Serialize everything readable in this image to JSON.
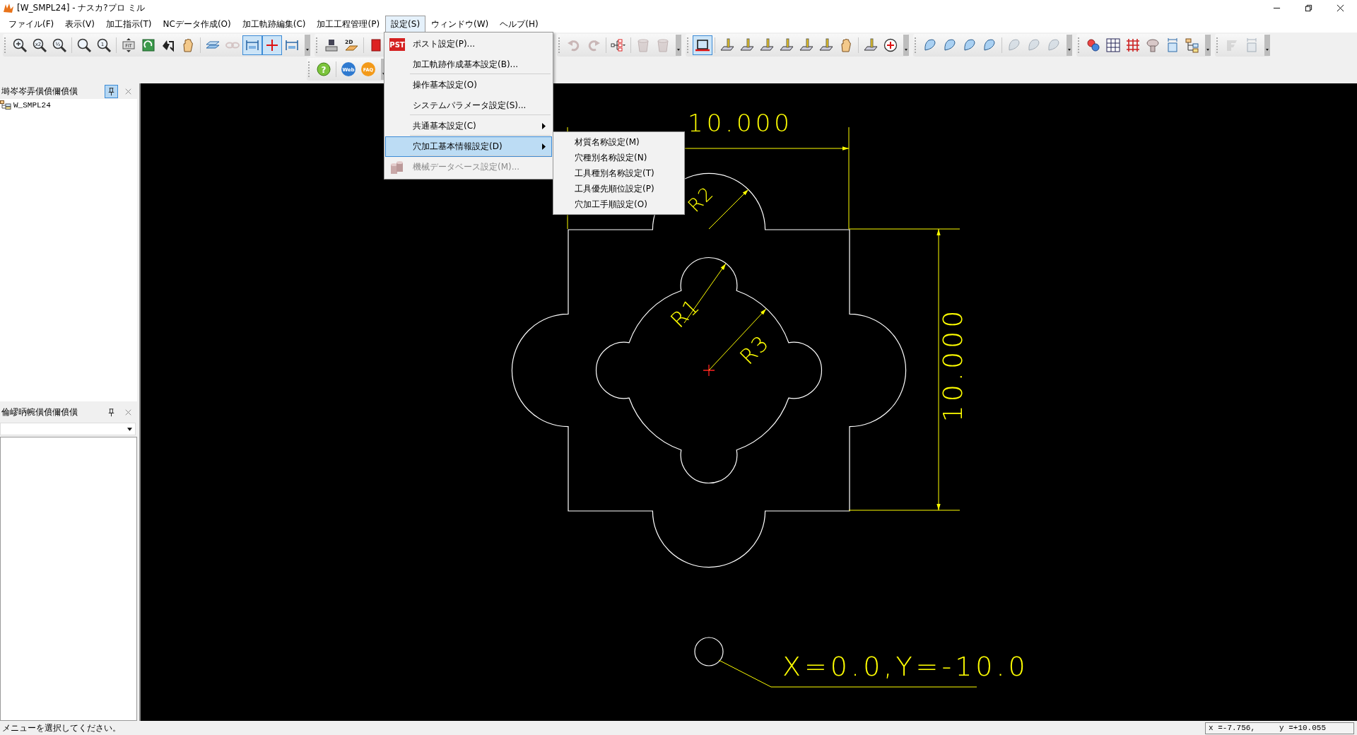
{
  "window": {
    "title": "[W_SMPL24] - ナスカ?プロ ミル"
  },
  "menu_bar": [
    {
      "label": "ファイル(F)",
      "selected": false
    },
    {
      "label": "表示(V)",
      "selected": false
    },
    {
      "label": "加工指示(T)",
      "selected": false
    },
    {
      "label": "NCデータ作成(O)",
      "selected": false
    },
    {
      "label": "加工軌跡編集(C)",
      "selected": false
    },
    {
      "label": "加工工程管理(P)",
      "selected": false
    },
    {
      "label": "設定(S)",
      "selected": true
    },
    {
      "label": "ウィンドウ(W)",
      "selected": false
    },
    {
      "label": "ヘルプ(H)",
      "selected": false
    }
  ],
  "toolbar": {
    "main": [
      [
        [
          {
            "selected": false,
            "disabled": false
          },
          {
            "selected": false,
            "disabled": false,
            "badge": "x2"
          },
          {
            "selected": false,
            "disabled": false,
            "badge": "½"
          }
        ],
        [
          {
            "selected": false,
            "disabled": false
          },
          {
            "selected": false,
            "disabled": false,
            "badge": "1"
          }
        ],
        [
          {
            "selected": false,
            "disabled": false,
            "badge": "FIT"
          },
          {
            "selected": false,
            "disabled": false
          },
          {
            "selected": false,
            "disabled": false
          },
          {
            "selected": false,
            "disabled": false
          }
        ],
        [
          {
            "selected": false,
            "disabled": false
          },
          {
            "selected": false,
            "disabled": true
          },
          {
            "selected": true,
            "disabled": false
          },
          {
            "selected": true,
            "disabled": false
          },
          {
            "selected": false,
            "disabled": false
          }
        ]
      ],
      [
        [
          {
            "selected": false,
            "disabled": false
          },
          {
            "selected": false,
            "disabled": false,
            "badge": "2D"
          }
        ],
        [
          {
            "selected": false,
            "disabled": false
          }
        ]
      ],
      [
        [
          {
            "selected": false,
            "disabled": true
          },
          {
            "selected": false,
            "disabled": true
          }
        ],
        [
          {
            "selected": false,
            "disabled": false
          }
        ],
        [
          {
            "selected": false,
            "disabled": true
          },
          {
            "selected": false,
            "disabled": true
          }
        ]
      ],
      [
        [
          {
            "selected": true,
            "disabled": false
          }
        ],
        [
          {
            "selected": false,
            "disabled": false
          },
          {
            "selected": false,
            "disabled": false
          },
          {
            "selected": false,
            "disabled": false
          },
          {
            "selected": false,
            "disabled": false
          },
          {
            "selected": false,
            "disabled": false
          },
          {
            "selected": false,
            "disabled": false
          },
          {
            "selected": false,
            "disabled": false
          }
        ],
        [
          {
            "selected": false,
            "disabled": false
          },
          {
            "selected": false,
            "disabled": false
          }
        ]
      ],
      [
        [
          {
            "selected": false,
            "disabled": false
          },
          {
            "selected": false,
            "disabled": false
          },
          {
            "selected": false,
            "disabled": false
          },
          {
            "selected": false,
            "disabled": false
          }
        ],
        [
          {
            "selected": false,
            "disabled": true
          },
          {
            "selected": false,
            "disabled": true
          },
          {
            "selected": false,
            "disabled": true
          }
        ]
      ],
      [
        [
          {
            "selected": false,
            "disabled": false
          },
          {
            "selected": false,
            "disabled": false
          },
          {
            "selected": false,
            "disabled": false
          },
          {
            "selected": false,
            "disabled": false
          },
          {
            "selected": false,
            "disabled": false
          },
          {
            "selected": false,
            "disabled": false
          }
        ]
      ],
      [
        [
          {
            "selected": false,
            "disabled": true
          },
          {
            "selected": false,
            "disabled": true
          }
        ]
      ]
    ],
    "secondary": [
      [
        [
          {
            "selected": false,
            "disabled": false,
            "badge": "?"
          }
        ],
        [
          {
            "selected": false,
            "disabled": false,
            "badge": "Web"
          },
          {
            "selected": false,
            "disabled": false,
            "badge": "FAQ"
          }
        ]
      ]
    ]
  },
  "settings_menu": {
    "items": [
      {
        "label": "ポスト設定(P)...",
        "badge": "PST",
        "disabled": false,
        "selected": false,
        "submenu": false,
        "separator_after": false
      },
      {
        "label": "加工軌跡作成基本設定(B)...",
        "disabled": false,
        "selected": false,
        "submenu": false,
        "separator_after": true
      },
      {
        "label": "操作基本設定(O)",
        "disabled": false,
        "selected": false,
        "submenu": false,
        "separator_after": false
      },
      {
        "label": "システムパラメータ設定(S)...",
        "disabled": false,
        "selected": false,
        "submenu": false,
        "separator_after": true
      },
      {
        "label": "共通基本設定(C)",
        "disabled": false,
        "selected": false,
        "submenu": true,
        "separator_after": true
      },
      {
        "label": "穴加工基本情報設定(D)",
        "disabled": false,
        "selected": true,
        "submenu": true,
        "separator_after": true
      },
      {
        "label": "機械データベース設定(M)...",
        "disabled": true,
        "selected": false,
        "submenu": false,
        "separator_after": false
      }
    ],
    "submenu": [
      {
        "label": "材質名称設定(M)"
      },
      {
        "label": "穴種別名称設定(N)"
      },
      {
        "label": "工具種別名称設定(T)"
      },
      {
        "label": "工具優先順位設定(P)"
      },
      {
        "label": "穴加工手順設定(O)"
      }
    ]
  },
  "panels": [
    {
      "title": "塒岑岑弄僙僨儞僨僙",
      "pinned": true,
      "tree": [
        {
          "label": "W_SMPL24"
        }
      ]
    },
    {
      "title": "倫嵺昞帵僙僨儞僨僙",
      "pinned": false
    }
  ],
  "drawing": {
    "top_dimension": "10.000",
    "right_dimension": "10.000",
    "radius_labels": [
      "R2",
      "R1",
      "R3"
    ],
    "point_label": "X=0.0,Y=-10.0"
  },
  "status_bar": {
    "message": "メニューを選択してください。",
    "x": "x =-7.756,",
    "y": "y =+10.055"
  }
}
